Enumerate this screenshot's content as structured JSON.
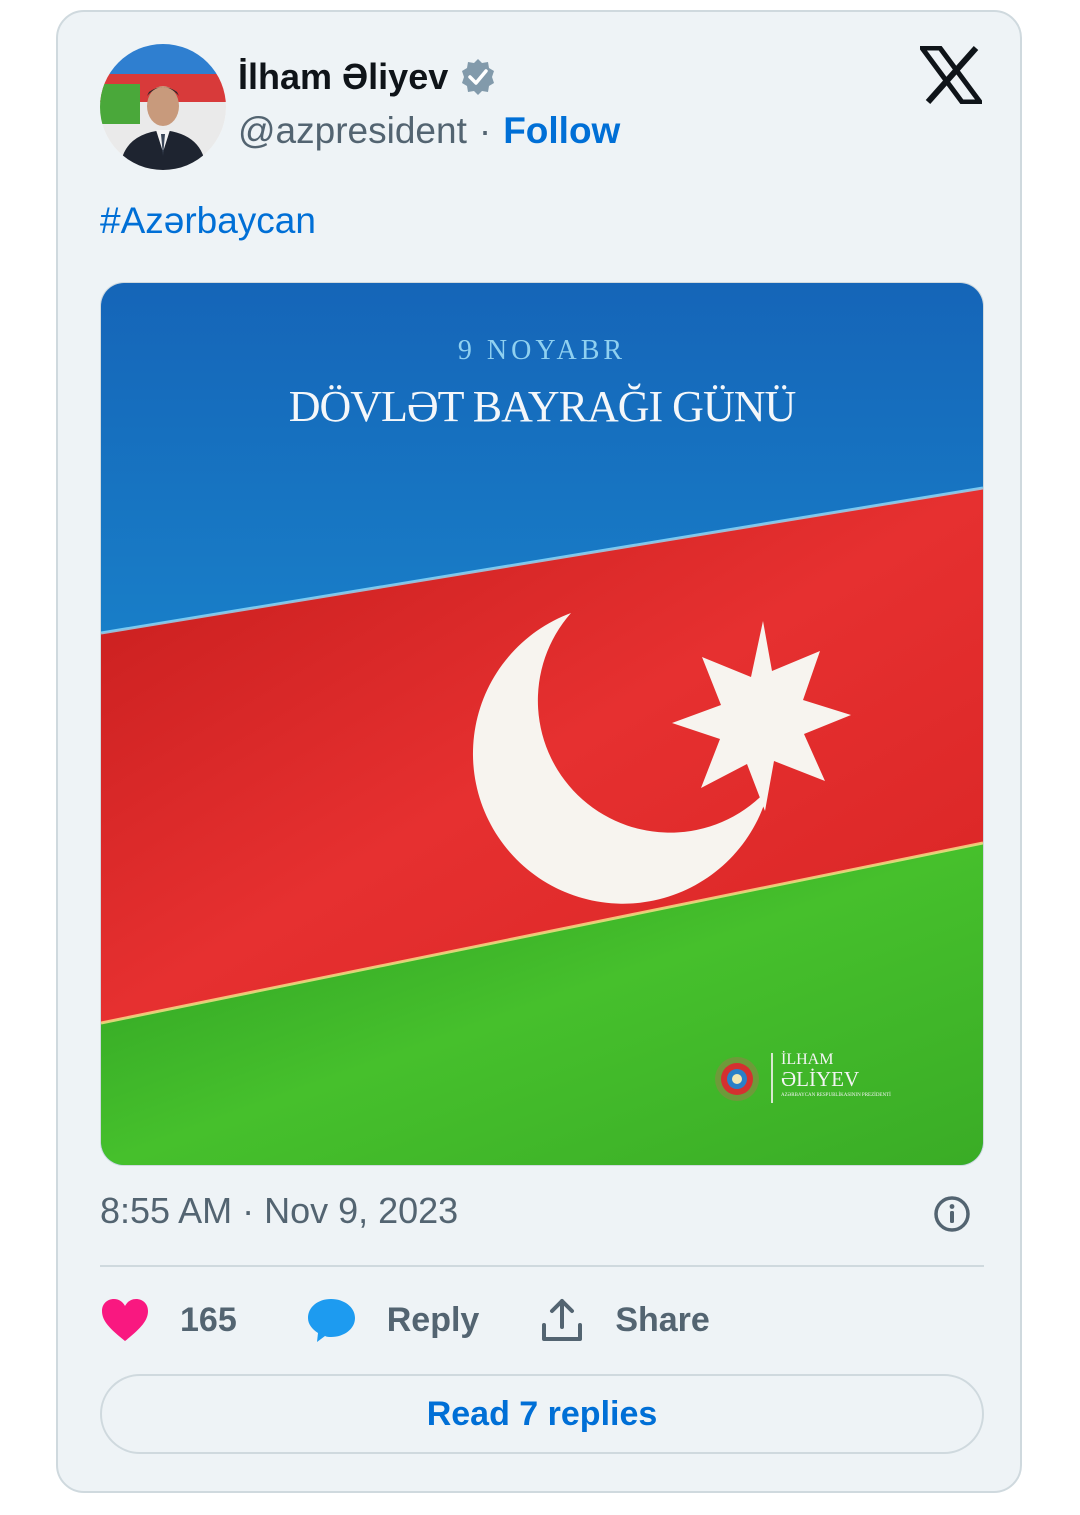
{
  "author": {
    "name": "İlham Əliyev",
    "handle": "@azpresident",
    "separator": "·",
    "follow_label": "Follow",
    "verified_icon": "verified-badge-icon"
  },
  "brand_icon": "x-logo-icon",
  "tweet": {
    "text": "#Azərbaycan",
    "timestamp": "8:55 AM · Nov 9, 2023"
  },
  "media": {
    "date_line": "9 NOYABR",
    "headline": "DÖVLƏT BAYRAĞI GÜNÜ",
    "logo_name_line1": "İLHAM",
    "logo_name_line2": "ƏLİYEV",
    "logo_subtitle": "AZƏRBAYCAN RESPUBLİKASININ PREZİDENTİ",
    "flag_colors": {
      "blue": "#1a8bd0",
      "red": "#e02a2a",
      "green": "#3fb52a"
    }
  },
  "actions": {
    "like_count": "165",
    "reply_label": "Reply",
    "share_label": "Share",
    "like_color": "#f91880",
    "reply_color": "#1d9bf0"
  },
  "footer": {
    "read_replies_label": "Read 7 replies"
  },
  "colors": {
    "accent": "#006fd6",
    "secondary_text": "#536471",
    "card_bg": "#eef3f6",
    "border": "#cfd9de"
  }
}
